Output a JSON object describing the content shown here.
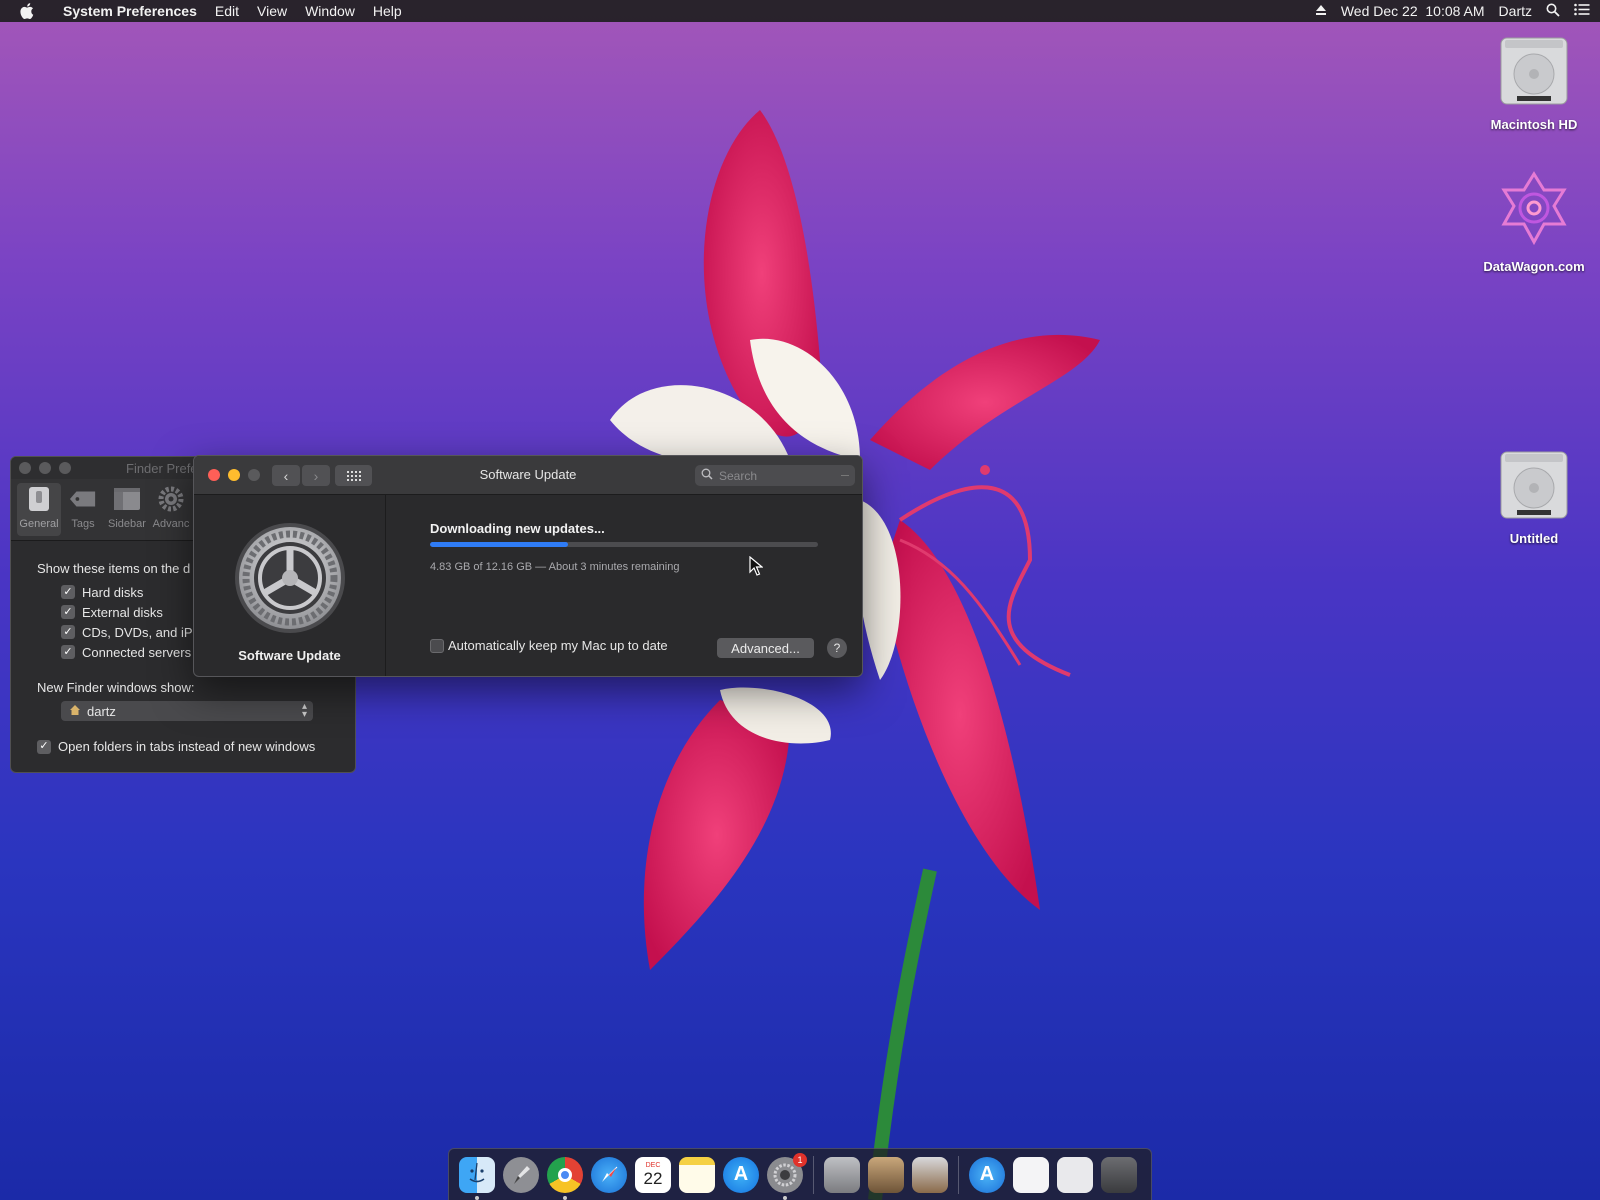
{
  "menubar": {
    "app_name": "System Preferences",
    "menus": [
      "Edit",
      "View",
      "Window",
      "Help"
    ],
    "clock": "Wed Dec 22  10:08 AM",
    "user": "Dartz"
  },
  "desktop": {
    "icons": [
      {
        "label": "Macintosh HD",
        "icon": "hard-disk-icon"
      },
      {
        "label": "DataWagon.com",
        "icon": "disk-image-icon"
      },
      {
        "label": "Untitled",
        "icon": "hard-disk-icon"
      }
    ]
  },
  "finder_prefs": {
    "title": "Finder Prefe",
    "tabs": [
      {
        "label": "General",
        "icon": "switch-icon"
      },
      {
        "label": "Tags",
        "icon": "tag-icon"
      },
      {
        "label": "Sidebar",
        "icon": "sidebar-icon"
      },
      {
        "label": "Advanc",
        "icon": "gear-icon"
      }
    ],
    "show_items_heading": "Show these items on the d",
    "items": [
      {
        "label": "Hard disks",
        "checked": true
      },
      {
        "label": "External disks",
        "checked": true
      },
      {
        "label": "CDs, DVDs, and iPo",
        "checked": true
      },
      {
        "label": "Connected servers",
        "checked": true
      }
    ],
    "new_window_heading": "New Finder windows show:",
    "new_window_value": "dartz",
    "open_in_tabs_label": "Open folders in tabs instead of new windows",
    "open_in_tabs_checked": true
  },
  "software_update": {
    "title": "Software Update",
    "search_placeholder": "Search",
    "pane_label": "Software Update",
    "status": "Downloading new updates...",
    "progress_fraction": 0.355,
    "progress_detail": "4.83 GB of 12.16 GB — About 3 minutes remaining",
    "auto_update_label": "Automatically keep my Mac up to date",
    "auto_update_checked": false,
    "advanced_button": "Advanced...",
    "help_button": "?"
  },
  "dock": {
    "apps": [
      "finder-icon",
      "launchpad-icon",
      "chrome-icon",
      "safari-icon",
      "calendar-icon",
      "notes-icon",
      "app-store-icon",
      "system-preferences-icon",
      "disk-utility-icon",
      "image-capture-icon",
      "installer-icon",
      "app-store-folder-icon",
      "document-icon",
      "preview-icon",
      "trash-icon"
    ],
    "calendar_month": "DEC",
    "calendar_day": "22",
    "system_prefs_badge": "1"
  },
  "colors": {
    "close": "#fe5f57",
    "minimize": "#febc2e",
    "zoom_inactive": "#5a5a5c",
    "accent": "#2f7cf6"
  }
}
